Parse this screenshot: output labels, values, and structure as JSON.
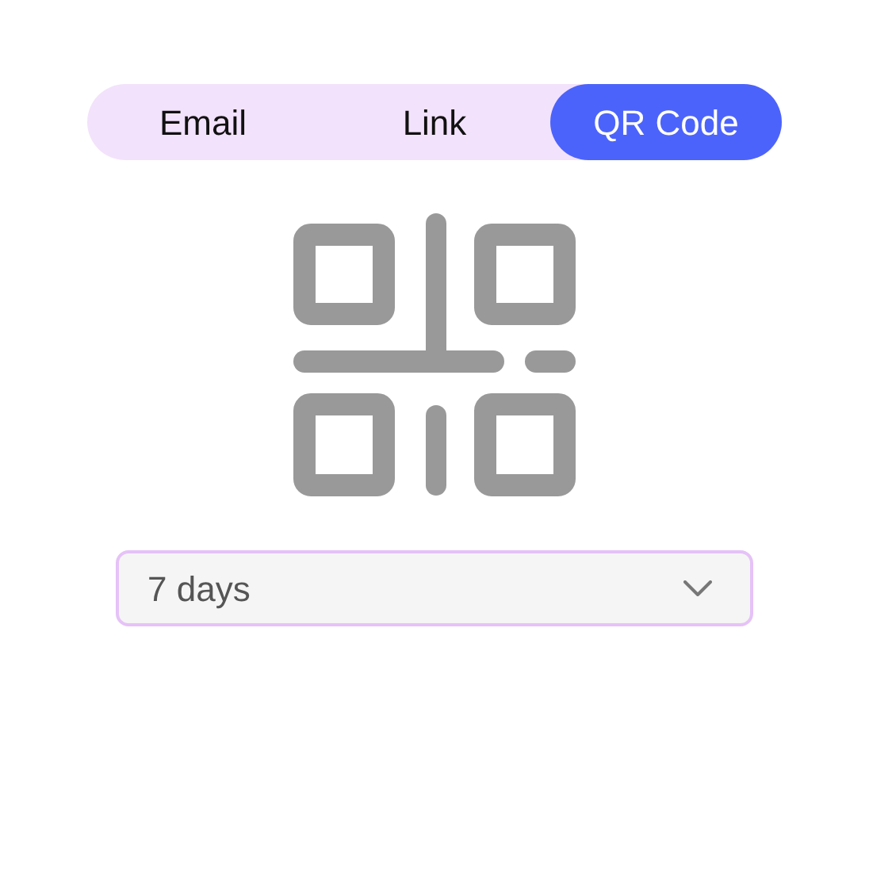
{
  "tabs": [
    {
      "label": "Email",
      "selected": false
    },
    {
      "label": "Link",
      "selected": false
    },
    {
      "label": "QR Code",
      "selected": true
    }
  ],
  "expiry": {
    "value": "7 days"
  }
}
